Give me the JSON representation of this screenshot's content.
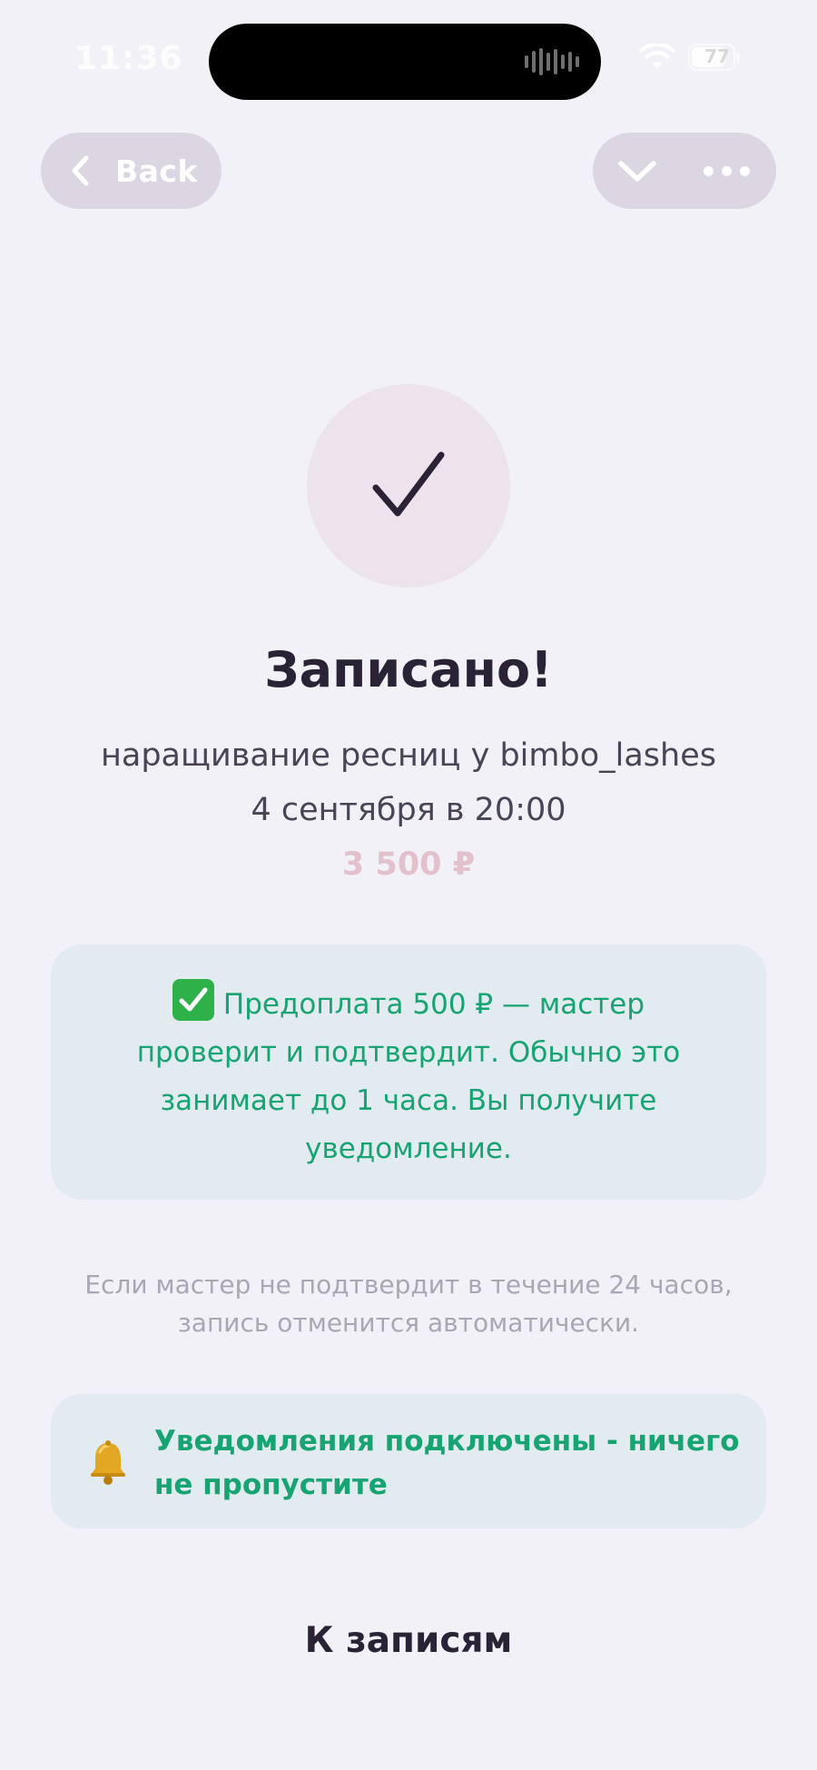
{
  "status_bar": {
    "time": "11:36",
    "battery_level": "77"
  },
  "header": {
    "back_label": "Back"
  },
  "success": {
    "title": "Записано!",
    "service": "наращивание ресниц у bimbo_lashes",
    "datetime": "4 сентября в 20:00",
    "price": "3 500 ₽"
  },
  "prepayment": {
    "text": "Предоплата 500 ₽ — мастер проверит и подтвердит. Обычно это занимает до 1 часа. Вы получите уведомление."
  },
  "note": {
    "text": "Если мастер не подтвердит в течение 24 часов, запись отменится автоматически."
  },
  "notifications": {
    "text": "Уведомления подключены - ничего не пропустите"
  },
  "footer": {
    "records_label": "К записям"
  },
  "colors": {
    "background": "#f3f1f8",
    "accent_green": "#17a372",
    "price_pink": "#e2c0cc",
    "title_dark": "#2a2235",
    "card_bg": "#e2ebef"
  }
}
